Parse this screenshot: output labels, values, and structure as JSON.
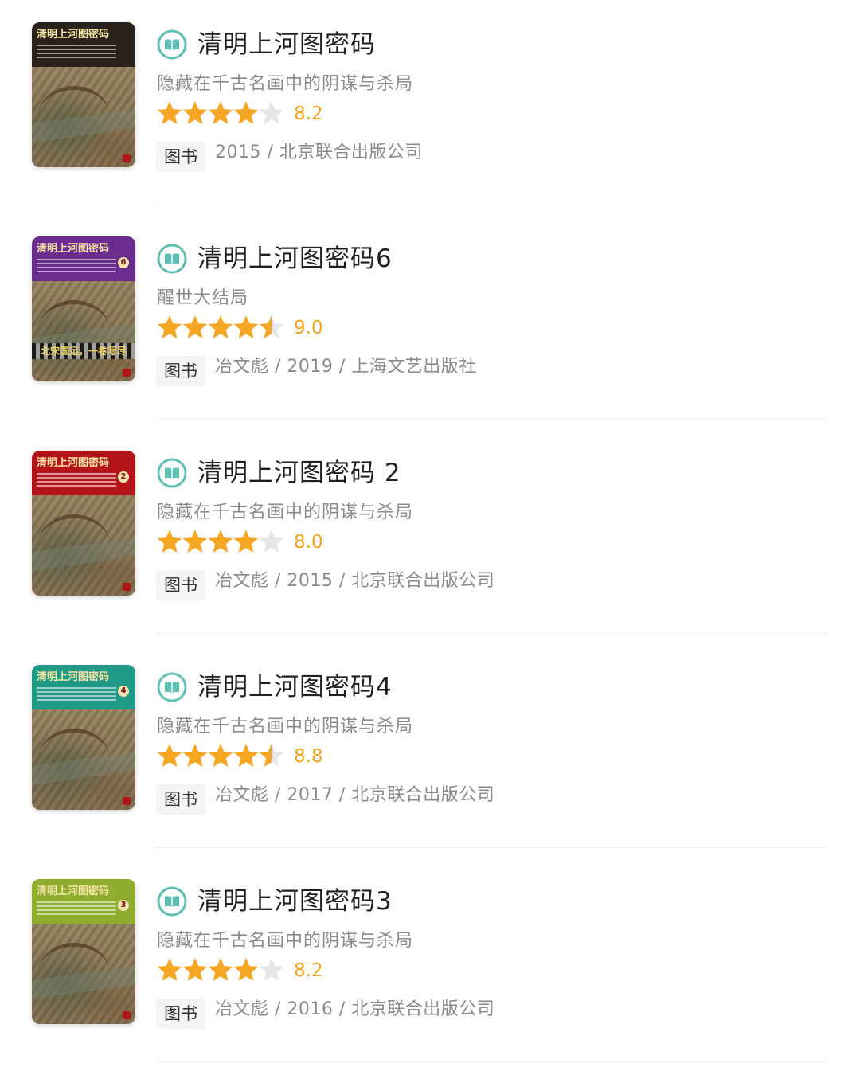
{
  "icon": "book-icon",
  "colors": {
    "accent_star": "#f5a623",
    "empty_star": "#e6e6e6",
    "rating_text": "#f2a51a",
    "icon_teal": "#5fbfb5"
  },
  "books": [
    {
      "title": "清明上河图密码",
      "subtitle": "隐藏在千古名画中的阴谋与杀局",
      "rating": "8.2",
      "stars": 4.0,
      "type": "图书",
      "meta": "2015 / 北京联合出版公司",
      "cover_title": "清明上河图密码",
      "cover_color": "#2a211a",
      "cover_volume": "",
      "cover_slogan": ""
    },
    {
      "title": "清明上河图密码6",
      "subtitle": "醒世大结局",
      "rating": "9.0",
      "stars": 4.5,
      "type": "图书",
      "meta": "冶文彪 / 2019 / 上海文艺出版社",
      "cover_title": "清明上河图密码",
      "cover_color": "#6a2d8f",
      "cover_volume": "6",
      "cover_slogan": "北宋国运，一卷写尽"
    },
    {
      "title": "清明上河图密码 2",
      "subtitle": "隐藏在千古名画中的阴谋与杀局",
      "rating": "8.0",
      "stars": 4.0,
      "type": "图书",
      "meta": "冶文彪 / 2015 / 北京联合出版公司",
      "cover_title": "清明上河图密码",
      "cover_color": "#b3141a",
      "cover_volume": "2",
      "cover_slogan": ""
    },
    {
      "title": "清明上河图密码4",
      "subtitle": "隐藏在千古名画中的阴谋与杀局",
      "rating": "8.8",
      "stars": 4.5,
      "type": "图书",
      "meta": "冶文彪 / 2017 / 北京联合出版公司",
      "cover_title": "清明上河图密码",
      "cover_color": "#1f9a86",
      "cover_volume": "4",
      "cover_slogan": ""
    },
    {
      "title": "清明上河图密码3",
      "subtitle": "隐藏在千古名画中的阴谋与杀局",
      "rating": "8.2",
      "stars": 4.0,
      "type": "图书",
      "meta": "冶文彪 / 2016 / 北京联合出版公司",
      "cover_title": "清明上河图密码",
      "cover_color": "#8fae2f",
      "cover_volume": "3",
      "cover_slogan": ""
    }
  ]
}
